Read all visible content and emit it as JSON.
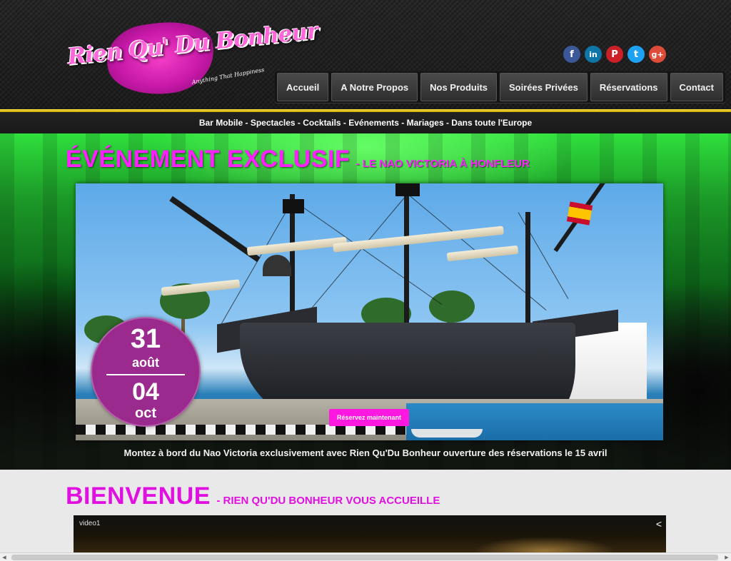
{
  "brand": {
    "logo_text": "Rien Qu' Du Bonheur",
    "logo_tagline": "Anything That Happiness"
  },
  "social": [
    {
      "name": "facebook-icon",
      "glyph": "f",
      "color": "#3b5998"
    },
    {
      "name": "linkedin-icon",
      "glyph": "in",
      "color": "#0e76a8"
    },
    {
      "name": "pinterest-icon",
      "glyph": "P",
      "color": "#cb2027"
    },
    {
      "name": "twitter-icon",
      "glyph": "t",
      "color": "#1da1f2"
    },
    {
      "name": "googleplus-icon",
      "glyph": "g+",
      "color": "#dd4b39"
    }
  ],
  "nav": {
    "items": [
      "Accueil",
      "A Notre Propos",
      "Nos Produits",
      "Soirées Privées",
      "Réservations",
      "Contact"
    ]
  },
  "tagline": "Bar Mobile - Spectacles - Cocktails - Evénements - Mariages - Dans toute l'Europe",
  "hero": {
    "title": "ÉVÉNEMENT EXCLUSIF",
    "subtitle": "- LE NAO VICTORIA À HONFLEUR",
    "date_start_day": "31",
    "date_start_month": "août",
    "date_end_day": "04",
    "date_end_month": "oct",
    "reserve_label": "Réservez maintenant",
    "caption": "Montez à bord du Nao Victoria exclusivement avec Rien Qu'Du Bonheur ouverture des réservations le 15 avril"
  },
  "welcome": {
    "title": "BIENVENUE",
    "subtitle": "- RIEN QU'DU BONHEUR VOUS ACCUEILLE",
    "video_label": "video1"
  },
  "colors": {
    "accent_magenta": "#ff20ff",
    "date_badge": "#9b2a8e",
    "separator_yellow": "#f6e04a",
    "hero_green": "#2ee03c"
  }
}
